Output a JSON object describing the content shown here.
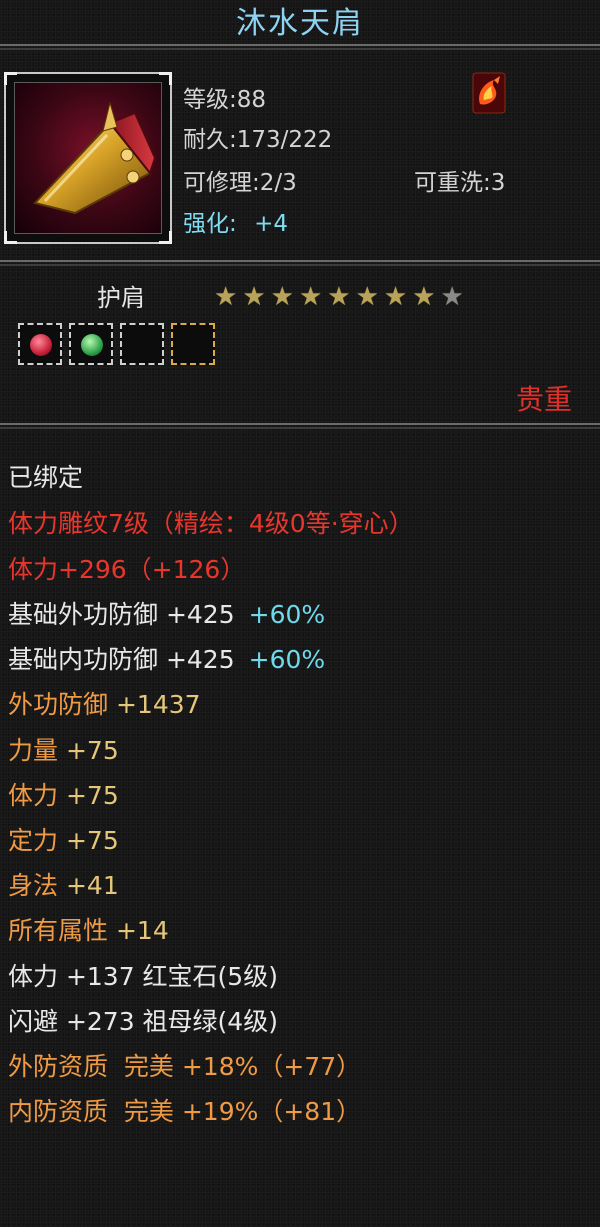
{
  "item": {
    "name": "沐水天肩",
    "level": "等级:88",
    "durability": "耐久:173/222",
    "repair": "可修理:2/3",
    "rewash": "可重洗:3",
    "enhance_label": "强化:",
    "enhance_value": "+4",
    "type": "护肩",
    "stars_total": 9,
    "stars_lit": 8,
    "quality": "贵重",
    "bound": "已绑定"
  },
  "icons": {
    "item": "pauldron-icon",
    "badge": "phoenix-badge-icon",
    "star": "star-icon",
    "gem_red": "ruby-gem-icon",
    "gem_green": "emerald-gem-icon"
  },
  "gems": [
    {
      "kind": "ruby",
      "color": "#c8203a"
    },
    {
      "kind": "emerald",
      "color": "#2fa34a"
    },
    {
      "kind": "empty",
      "color": ""
    },
    {
      "kind": "empty-gold",
      "color": ""
    }
  ],
  "attributes": [
    {
      "text": "体力雕纹7级（精绘：4级0等·穿心）",
      "color": "red"
    },
    {
      "text": "体力+296（+126）",
      "color": "red"
    },
    {
      "text": "基础外功防御 +425",
      "extra": "+60%",
      "color": "white"
    },
    {
      "text": "基础内功防御 +425",
      "extra": "+60%",
      "color": "white"
    },
    {
      "prefix": "外功防御",
      "text": " +1437",
      "color": "gold",
      "prefix_color": "orange"
    },
    {
      "prefix": "力量",
      "text": " +75",
      "color": "gold",
      "prefix_color": "orange"
    },
    {
      "prefix": "体力",
      "text": " +75",
      "color": "gold",
      "prefix_color": "orange"
    },
    {
      "prefix": "定力",
      "text": " +75",
      "color": "gold",
      "prefix_color": "orange"
    },
    {
      "prefix": "身法",
      "text": " +41",
      "color": "gold",
      "prefix_color": "orange"
    },
    {
      "prefix": "所有属性",
      "text": " +14",
      "color": "gold",
      "prefix_color": "orange"
    },
    {
      "text": "体力 +137 红宝石(5级)",
      "color": "white"
    },
    {
      "text": "闪避 +273 祖母绿(4级)",
      "color": "white"
    },
    {
      "text": "外防资质  完美 +18%（+77）",
      "color": "orange"
    },
    {
      "text": "内防资质  完美 +19%（+81）",
      "color": "orange"
    }
  ],
  "colors": {
    "title": "#8fd3f2",
    "red": "#e8362c",
    "gold": "#e6c67a",
    "orange": "#ef9a45",
    "cyan": "#6fd8ea",
    "white": "#e8e8e8"
  }
}
